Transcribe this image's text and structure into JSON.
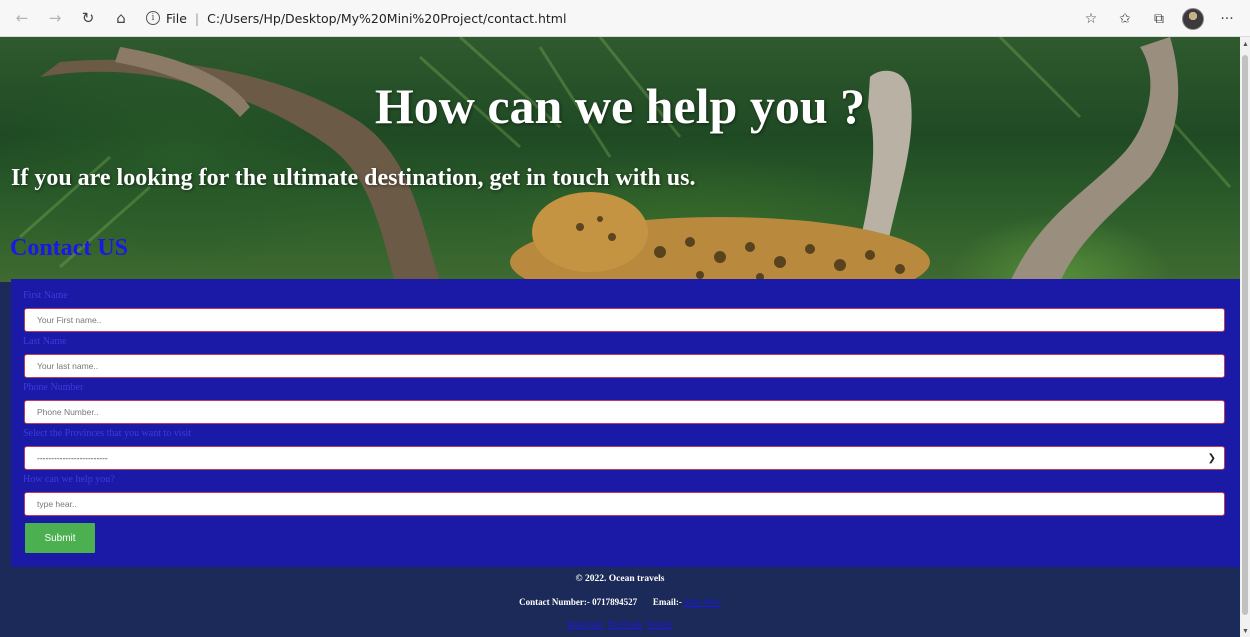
{
  "browser": {
    "back_icon": "back-arrow-icon",
    "forward_icon": "forward-arrow-icon",
    "refresh_icon": "refresh-icon",
    "home_icon": "home-icon",
    "info_icon": "info-icon",
    "file_label": "File",
    "url": "C:/Users/Hp/Desktop/My%20Mini%20Project/contact.html",
    "right_icons": [
      "add-favorite-icon",
      "favorites-icon",
      "collections-icon",
      "profile-avatar",
      "more-icon"
    ],
    "more_label": "···"
  },
  "hero": {
    "title": "How can we help you ?",
    "subtitle": "If you are looking for the ultimate destination, get in touch with us.",
    "section_title": "Contact US"
  },
  "form": {
    "first_name_label": "First Name",
    "first_name_placeholder": "Your First name..",
    "last_name_label": "Last Name",
    "last_name_placeholder": "Your last name..",
    "phone_label": "Phone Number",
    "phone_placeholder": "Phone Number..",
    "province_label": "Select the Provinces that you want to visit",
    "province_selected": "-------------------------",
    "help_label": "How can we help you?",
    "help_placeholder": "type hear..",
    "submit_label": "Submit"
  },
  "footer": {
    "copyright": "© 2022. Ocean travels",
    "contact_label": "Contact Number:- 0717894527",
    "email_label": "Email:-",
    "email_link": "Mail Now",
    "social_links": [
      "Instagram",
      "Facebook",
      "Twitter"
    ]
  },
  "colors": {
    "form_background": "#1b1aa6",
    "label_color": "#3b3ae0",
    "section_title": "#1c17e6",
    "submit_button": "#4caf50",
    "footer_background": "#1b2a58",
    "field_border": "#c23b5a"
  }
}
